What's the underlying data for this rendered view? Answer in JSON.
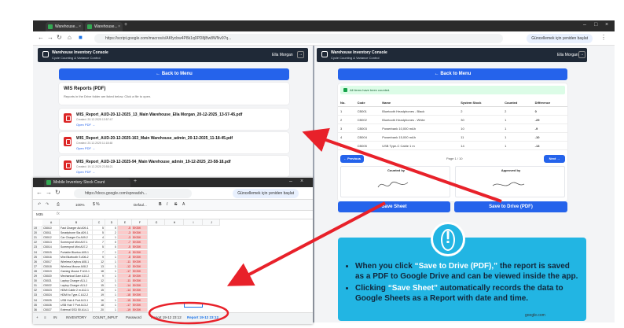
{
  "browser": {
    "tabs": [
      "Warehouse...",
      "Warehouse..."
    ],
    "url": "https://script.google.com/macros/s/AKfycbw4P8k1q0PD8jBw8WNv97q...",
    "update_label": "Güncellemek için yeniden başlat"
  },
  "left_app": {
    "title": "Warehouse Inventory Console",
    "subtitle": "Cycle Counting & Variance Control",
    "user": "Ella Morgan",
    "back_label": "← Back to Menu",
    "reports_title": "WIS Reports (PDF)",
    "reports_desc": "Reports in the Drive folder are listed below. Click a file to open.",
    "files": [
      {
        "name": "WIS_Report_AUD-20-12-2025_13_Main Warehouse_Ella Morgan_20-12-2025_13-57-45.pdf",
        "created": "Created: 20.12.2025 13:57:47",
        "open": "Open PDF →"
      },
      {
        "name": "WIS_Report_AUD-20-12-2025-163_Main Warehouse_admin_20-12-2025_11-18-45.pdf",
        "created": "Created: 20.12.2025 11:18:48",
        "open": "Open PDF →"
      },
      {
        "name": "WIS_Report_AUD-19-12-2025-94_Main Warehouse_admin_19-12-2025_23-58-18.pdf",
        "created": "Created: 19.12.2025 23:58:21",
        "open": "Open PDF →"
      }
    ]
  },
  "right_app": {
    "title": "Warehouse Inventory Console",
    "subtitle": "Cycle Counting & Variance Control",
    "user": "Ella Morgan",
    "back_label": "← Back to Menu",
    "success_msg": "All items have been counted.",
    "columns": [
      "No.",
      "Code",
      "Name",
      "System Stock",
      "Counted",
      "Difference"
    ],
    "rows": [
      [
        "1",
        "CB001",
        "Bluetooth Headphones - Black",
        "2",
        "2",
        "0"
      ],
      [
        "2",
        "CB002",
        "Bluetooth Headphones - White",
        "30",
        "1",
        "-29"
      ],
      [
        "3",
        "CB003",
        "Powerbank 10,000 mAh",
        "10",
        "1",
        "-9"
      ],
      [
        "4",
        "CB004",
        "Powerbank 15,000 mAh",
        "11",
        "1",
        "-10"
      ],
      [
        "5",
        "CB005",
        "USB Type-C Cable 1 m",
        "14",
        "1",
        "-13"
      ]
    ],
    "prev_label": "← Previous",
    "page_label": "Page 1 / 10",
    "next_label": "Next →",
    "counted_by": "Counted by",
    "approved_by": "Approved by",
    "save_sheet": "Save Sheet",
    "save_drive": "Save to Drive (PDF)"
  },
  "sheets": {
    "title": "Mobile Inventory Stock Count",
    "url": "https://docs.google.com/spreadsh...",
    "update_label": "Güncellemek için yeniden başlat",
    "cell_ref": "M35",
    "zoom": "100%",
    "font": "Defaul...",
    "rows": [
      [
        "CB010",
        "Fast Charger Ad A09-1",
        "5",
        "0",
        "-5",
        "EKSIK"
      ],
      [
        "CB011",
        "Smartphone Sta A09-1",
        "5",
        "2",
        "-3",
        "EKSIK"
      ],
      [
        "CB012",
        "Car Charger Du A09-2",
        "4",
        "1",
        "-3",
        "EKSIK"
      ],
      [
        "CB013",
        "Screenprot Mini A07-1",
        "7",
        "0",
        "-7",
        "EKSIK"
      ],
      [
        "CB014",
        "Screenprot Mini A07-2",
        "5",
        "0",
        "-5",
        "EKSIK"
      ],
      [
        "CB015",
        "Portable Bluetoo A05-1",
        "7",
        "1",
        "-6",
        "EKSIK"
      ],
      [
        "CB016",
        "Mini Bluetooth S A06-2",
        "9",
        "1",
        "-8",
        "EKSIK"
      ],
      [
        "CB017",
        "Wireless Keybos A08-1",
        "12",
        "1",
        "-11",
        "EKSIK"
      ],
      [
        "CB018",
        "Wireless Mouse A08-2",
        "13",
        "1",
        "-12",
        "EKSIK"
      ],
      [
        "CB019",
        "Gaming Mouse F A10-1",
        "18",
        "1",
        "-17",
        "EKSIK"
      ],
      [
        "CB020",
        "Mechanical Gam A10-2",
        "9",
        "1",
        "-8",
        "EKSIK"
      ],
      [
        "CB021",
        "Laptop Charger A11-1",
        "12",
        "1",
        "-11",
        "EKSIK"
      ],
      [
        "CB022",
        "Laptop Charger A11-2",
        "15",
        "1",
        "-14",
        "EKSIK"
      ],
      [
        "CB023",
        "HDMI Cable 2 m A12-1",
        "15",
        "1",
        "-14",
        "EKSIK"
      ],
      [
        "CB024",
        "HDMI to Type-C A12-2",
        "19",
        "1",
        "-18",
        "EKSIK"
      ],
      [
        "CB025",
        "USB Hub 4 Port A13-1",
        "16",
        "1",
        "-15",
        "EKSIK"
      ],
      [
        "CB026",
        "USB Hub 7 Port A13-2",
        "18",
        "1",
        "-17",
        "EKSIK"
      ],
      [
        "CB027",
        "External SSD 50 A14-1",
        "20",
        "1",
        "-19",
        "EKSIK"
      ]
    ],
    "row_numbers": [
      "19",
      "20",
      "21",
      "22",
      "23",
      "24",
      "25",
      "26",
      "27",
      "28",
      "29",
      "30",
      "31",
      "32",
      "33",
      "34",
      "35",
      "36"
    ],
    "col_headers": [
      "A",
      "B",
      "C",
      "D",
      "E",
      "F",
      "G",
      "H",
      "I",
      "J",
      "K"
    ],
    "sheet_tabs": [
      "+",
      "≡",
      "IN",
      "INVENTORY",
      "COUNT_INPUT",
      "Password",
      "Report 19-12 23:12",
      "Report 19-12 23:12"
    ]
  },
  "info_box": {
    "bullet1_pre": "When you click ",
    "bullet1_hl": "“Save to Drive (PDF),”",
    "bullet1_post": " the report is saved as a PDF to Google Drive and can be viewed inside the app.",
    "bullet2_pre": "Clicking ",
    "bullet2_hl": "“Save Sheet”",
    "bullet2_post": " automatically records the data to Google Sheets as a Report with date and time."
  },
  "footer_text": "google.com",
  "colors": {
    "accent": "#2563eb",
    "info_bg": "#22b5e3",
    "arrow": "#e8212a"
  }
}
